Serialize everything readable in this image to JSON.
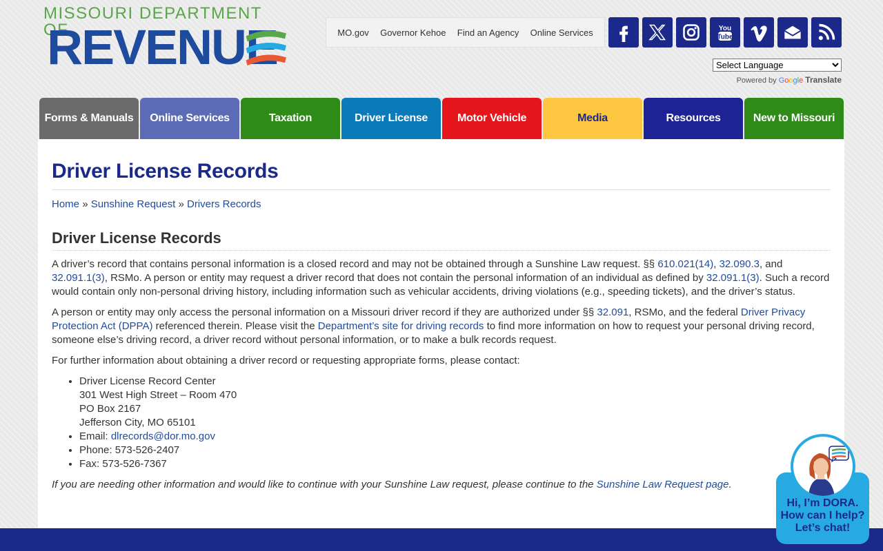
{
  "logo": {
    "top_text": "MISSOURI DEPARTMENT OF",
    "main_text": "REVENUE"
  },
  "utility_links": [
    "MO.gov",
    "Governor Kehoe",
    "Find an Agency",
    "Online Services"
  ],
  "social_icons": [
    "facebook-icon",
    "x-icon",
    "instagram-icon",
    "youtube-icon",
    "vimeo-icon",
    "email-icon",
    "rss-icon"
  ],
  "language": {
    "select_label": "Select Language",
    "powered_by": "Powered by",
    "google": "Google",
    "translate": "Translate"
  },
  "nav": [
    {
      "label": "Forms & Manuals",
      "color": "#6b6b6b"
    },
    {
      "label": "Online Services",
      "color": "#5b6bb5"
    },
    {
      "label": "Taxation",
      "color": "#2e8b17"
    },
    {
      "label": "Driver License",
      "color": "#0a7ab8"
    },
    {
      "label": "Motor Vehicle",
      "color": "#e4161b"
    },
    {
      "label": "Media",
      "color": "#fdc741"
    },
    {
      "label": "Resources",
      "color": "#1d2394"
    },
    {
      "label": "New to Missouri",
      "color": "#2e8b17"
    }
  ],
  "page": {
    "title": "Driver License Records",
    "breadcrumb": {
      "home": "Home",
      "sep": "»",
      "sunshine": "Sunshine Request",
      "current": "Drivers Records"
    },
    "section_title": "Driver License Records",
    "p1": {
      "t1": "A driver’s record that contains personal information is a closed record and may not be obtained through a Sunshine Law request. §§ ",
      "l1": "610.021(14)",
      "t2": ", ",
      "l2": "32.090.3",
      "t3": ", and ",
      "l3": "32.091.1(3)",
      "t4": ", RSMo. A person or entity may request a driver record that does not contain the personal information of an individual as defined by ",
      "l4": "32.091.1(3)",
      "t5": ". Such a record would contain only non-personal driving history, including information such as vehicular accidents, driving violations (e.g., speeding tickets), and the driver’s status."
    },
    "p2": {
      "t1": "A person or entity may only access the personal information on a Missouri driver record if they are authorized under §§ ",
      "l1": "32.091",
      "t2": ", RSMo, and the federal ",
      "l2": "Driver Privacy Protection Act (DPPA)",
      "t3": " referenced therein. Please visit the ",
      "l3": "Department’s site for driving records",
      "t4": " to find more information on how to request your personal driving record, someone else’s driving record, a driver record without personal information, or to make a bulk records request."
    },
    "p3": "For further information about obtaining a driver record or requesting appropriate forms, please contact:",
    "contact": {
      "name": "Driver License Record Center",
      "street": "301 West High Street – Room 470",
      "pobox": "PO Box 2167",
      "city": "Jefferson City, MO 65101",
      "email_label": "Email: ",
      "email": "dlrecords@dor.mo.gov",
      "phone": "Phone: 573-526-2407",
      "fax": "Fax: 573-526-7367"
    },
    "note": {
      "t1": "If you are needing other information and would like to continue with your Sunshine Law request, please continue to the ",
      "link": "Sunshine Law Request page",
      "t2": "."
    }
  },
  "dora": {
    "line1": "Hi, I’m DORA.",
    "line2": "How can I help?",
    "line3": "Let’s chat!"
  }
}
